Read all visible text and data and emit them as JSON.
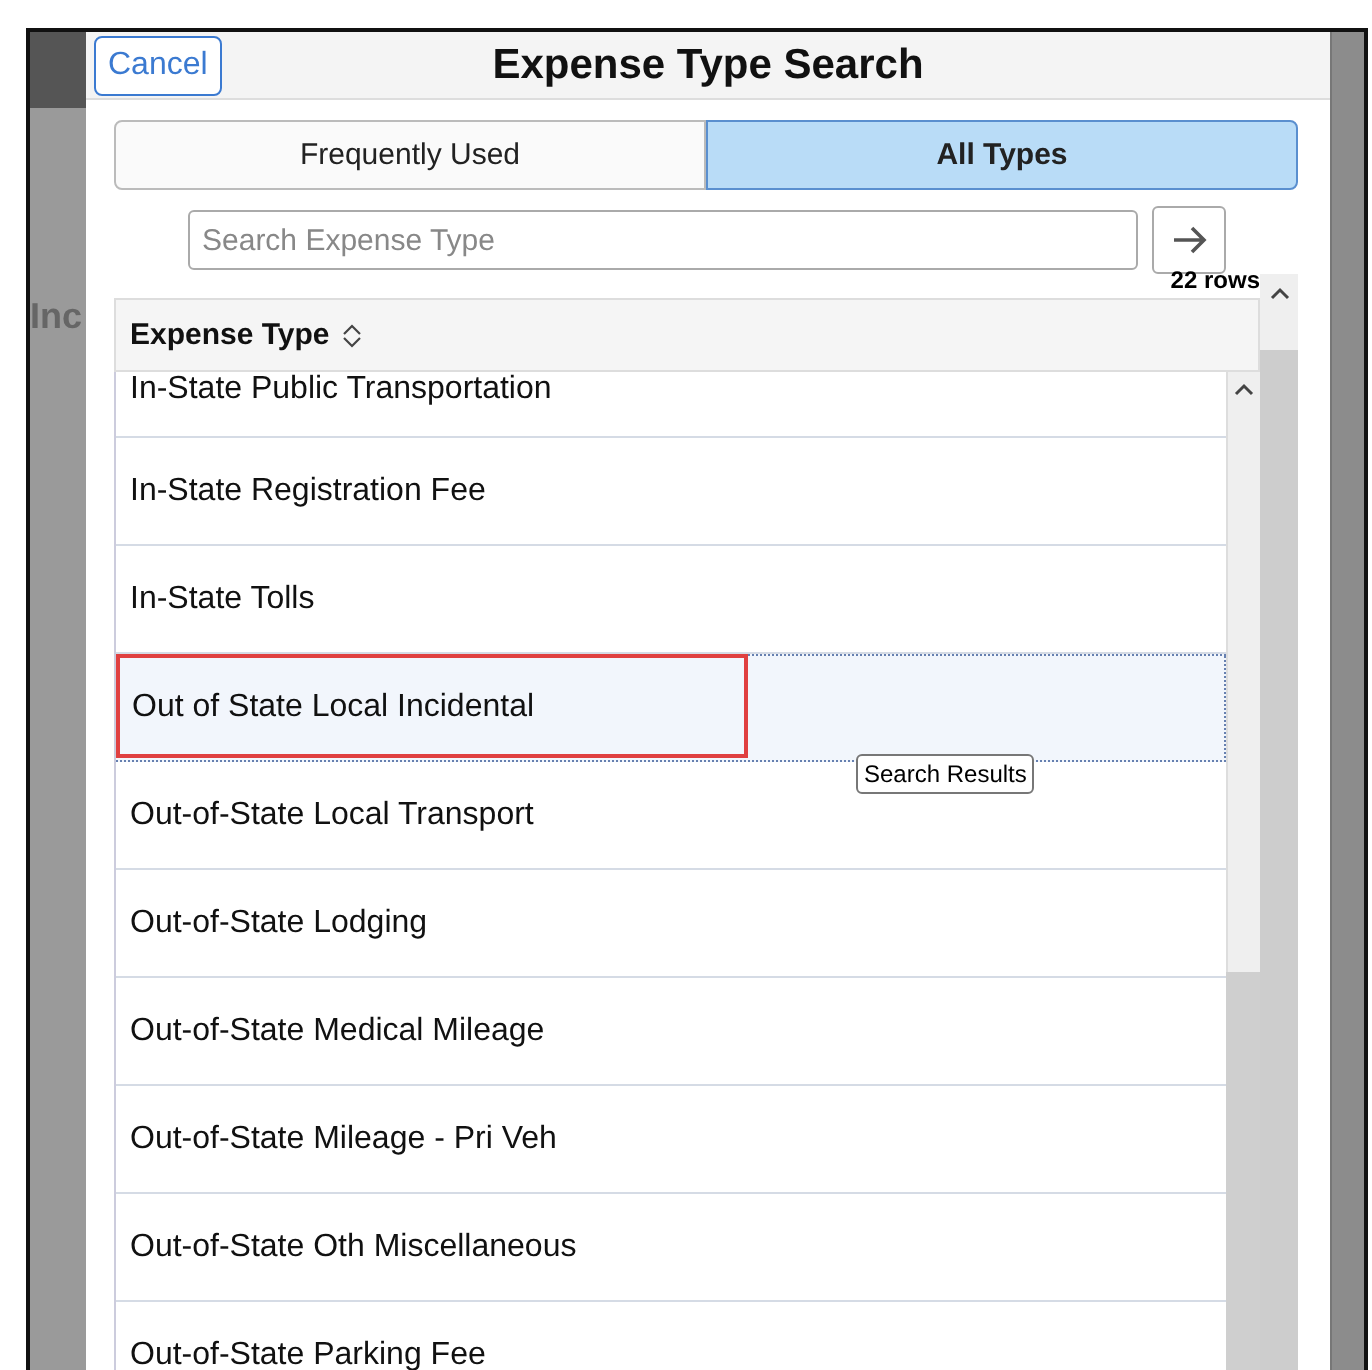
{
  "background": {
    "heading": "Inc"
  },
  "dialog": {
    "cancel": "Cancel",
    "title": "Expense Type Search"
  },
  "tabs": [
    {
      "label": "Frequently Used",
      "selected": false
    },
    {
      "label": "All Types",
      "selected": true
    }
  ],
  "search": {
    "placeholder": "Search Expense Type"
  },
  "results": {
    "count": "22 rows",
    "column": "Expense Type",
    "tooltip": "Search Results",
    "rows": [
      {
        "label": "In-State Public Transportation",
        "selected": false,
        "highlighted": false
      },
      {
        "label": "In-State Registration Fee",
        "selected": false,
        "highlighted": false
      },
      {
        "label": "In-State Tolls",
        "selected": false,
        "highlighted": false
      },
      {
        "label": "Out of State Local Incidental",
        "selected": true,
        "highlighted": true
      },
      {
        "label": "Out-of-State Local Transport",
        "selected": false,
        "highlighted": false
      },
      {
        "label": "Out-of-State Lodging",
        "selected": false,
        "highlighted": false
      },
      {
        "label": "Out-of-State Medical Mileage",
        "selected": false,
        "highlighted": false
      },
      {
        "label": "Out-of-State Mileage - Pri Veh",
        "selected": false,
        "highlighted": false
      },
      {
        "label": "Out-of-State Oth Miscellaneous",
        "selected": false,
        "highlighted": false
      },
      {
        "label": "Out-of-State Parking Fee",
        "selected": false,
        "highlighted": false
      }
    ]
  }
}
